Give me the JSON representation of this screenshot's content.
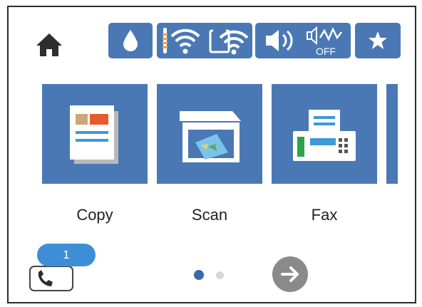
{
  "header": {
    "home_icon": "home-icon",
    "status_buttons": [
      {
        "name": "ink-levels",
        "icons": [
          "ink-drop-icon"
        ]
      },
      {
        "name": "network-status",
        "icons": [
          "wifi-icon",
          "wifi-direct-icon"
        ]
      },
      {
        "name": "sound-settings",
        "icons": [
          "speaker-icon",
          "quiet-mode-off-icon"
        ]
      },
      {
        "name": "favorites",
        "icons": [
          "star-icon"
        ]
      }
    ]
  },
  "tiles": [
    {
      "label": "Copy",
      "icon": "copy-icon"
    },
    {
      "label": "Scan",
      "icon": "scan-icon"
    },
    {
      "label": "Fax",
      "icon": "fax-icon"
    }
  ],
  "footer": {
    "job_count": "1",
    "job_icon": "fax-job-icon",
    "page_indicator": {
      "current": 1,
      "total": 2
    },
    "next_icon": "arrow-right-icon"
  },
  "colors": {
    "tile_blue": "#4a78b5",
    "badge_blue": "#3c8fd6",
    "next_gray": "#8a8a8a"
  }
}
